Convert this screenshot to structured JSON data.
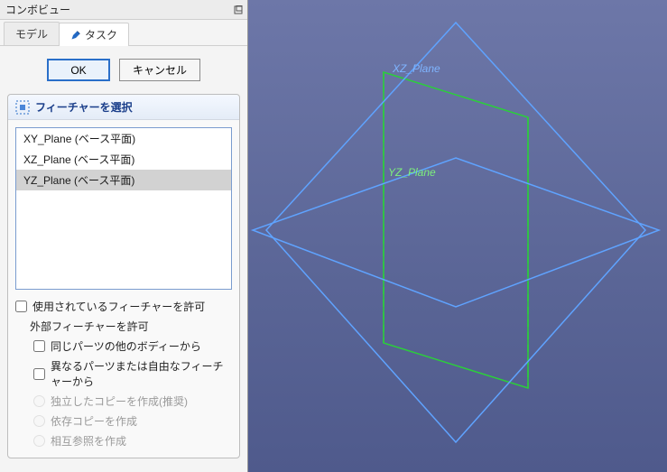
{
  "panel": {
    "title": "コンボビュー"
  },
  "tabs": {
    "model": "モデル",
    "task": "タスク"
  },
  "buttons": {
    "ok": "OK",
    "cancel": "キャンセル"
  },
  "task": {
    "header": "フィーチャーを選択"
  },
  "list": {
    "items": [
      "XY_Plane (ベース平面)",
      "XZ_Plane (ベース平面)",
      "YZ_Plane (ベース平面)"
    ]
  },
  "options": {
    "allow_used": "使用されているフィーチャーを許可",
    "allow_external": "外部フィーチャーを許可",
    "same_part_other_body": "同じパーツの他のボディーから",
    "diff_part_or_free": "異なるパーツまたは自由なフィーチャーから",
    "copy_independent": "独立したコピーを作成(推奨)",
    "copy_dependent": "依存コピーを作成",
    "cross_ref": "相互参照を作成"
  },
  "viewport": {
    "labels": {
      "xz": "XZ_Plane",
      "yz": "YZ_Plane"
    }
  }
}
